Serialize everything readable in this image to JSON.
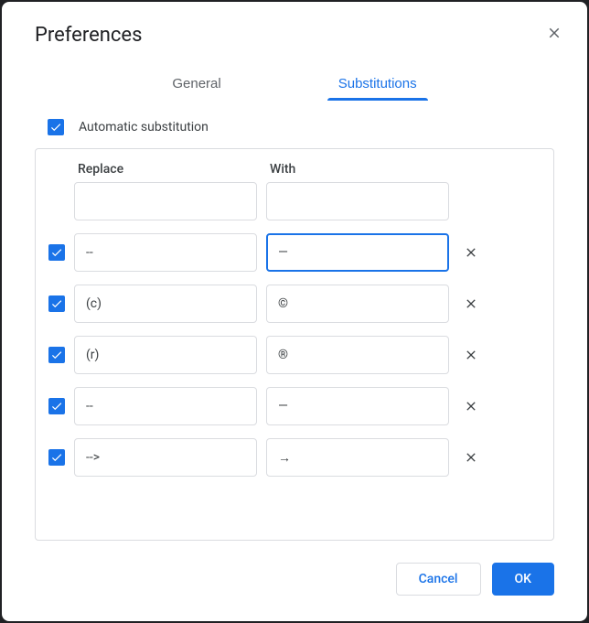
{
  "dialog": {
    "title": "Preferences"
  },
  "tabs": {
    "general": "General",
    "substitutions": "Substitutions"
  },
  "autoSubstitution": {
    "checked": true,
    "label": "Automatic substitution"
  },
  "columns": {
    "replace": "Replace",
    "with": "With"
  },
  "rows": [
    {
      "checked": null,
      "replace": "",
      "with": "",
      "deletable": false,
      "focused": null
    },
    {
      "checked": true,
      "replace": "--",
      "with": "—",
      "deletable": true,
      "focused": "with"
    },
    {
      "checked": true,
      "replace": "(c)",
      "with": "©",
      "deletable": true,
      "focused": null
    },
    {
      "checked": true,
      "replace": "(r)",
      "with": "®",
      "deletable": true,
      "focused": null
    },
    {
      "checked": true,
      "replace": "--",
      "with": "—",
      "deletable": true,
      "focused": null
    },
    {
      "checked": true,
      "replace": "-->",
      "with": "→",
      "deletable": true,
      "focused": null
    }
  ],
  "footer": {
    "cancel": "Cancel",
    "ok": "OK"
  }
}
